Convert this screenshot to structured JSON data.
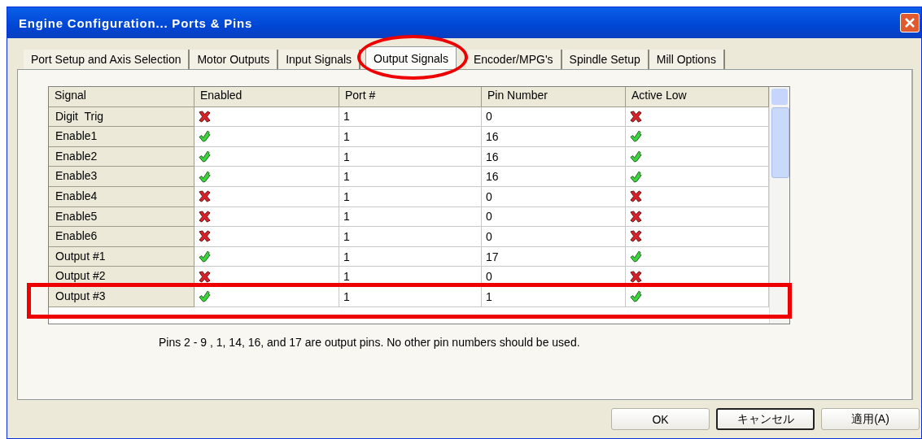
{
  "window": {
    "title": "Engine Configuration... Ports & Pins"
  },
  "tabs": [
    {
      "label": "Port Setup and Axis Selection",
      "selected": false
    },
    {
      "label": "Motor Outputs",
      "selected": false
    },
    {
      "label": "Input Signals",
      "selected": false
    },
    {
      "label": "Output Signals",
      "selected": true
    },
    {
      "label": "Encoder/MPG's",
      "selected": false
    },
    {
      "label": "Spindle Setup",
      "selected": false
    },
    {
      "label": "Mill Options",
      "selected": false
    }
  ],
  "table": {
    "columns": [
      "Signal",
      "Enabled",
      "Port #",
      "Pin Number",
      "Active Low"
    ],
    "rows": [
      {
        "signal": "Digit  Trig",
        "enabled": false,
        "port": "1",
        "pin": "0",
        "active_low": false
      },
      {
        "signal": "Enable1",
        "enabled": true,
        "port": "1",
        "pin": "16",
        "active_low": true
      },
      {
        "signal": "Enable2",
        "enabled": true,
        "port": "1",
        "pin": "16",
        "active_low": true
      },
      {
        "signal": "Enable3",
        "enabled": true,
        "port": "1",
        "pin": "16",
        "active_low": true
      },
      {
        "signal": "Enable4",
        "enabled": false,
        "port": "1",
        "pin": "0",
        "active_low": false
      },
      {
        "signal": "Enable5",
        "enabled": false,
        "port": "1",
        "pin": "0",
        "active_low": false
      },
      {
        "signal": "Enable6",
        "enabled": false,
        "port": "1",
        "pin": "0",
        "active_low": false
      },
      {
        "signal": "Output #1",
        "enabled": true,
        "port": "1",
        "pin": "17",
        "active_low": true
      },
      {
        "signal": "Output #2",
        "enabled": false,
        "port": "1",
        "pin": "0",
        "active_low": false
      },
      {
        "signal": "Output #3",
        "enabled": true,
        "port": "1",
        "pin": "1",
        "active_low": true
      }
    ]
  },
  "note": "Pins 2 - 9 , 1, 14, 16, and 17 are output pins. No  other pin numbers should be used.",
  "buttons": [
    {
      "label": "OK",
      "default": false
    },
    {
      "label": "キャンセル",
      "default": true
    },
    {
      "label": "適用(A)",
      "default": false
    }
  ]
}
